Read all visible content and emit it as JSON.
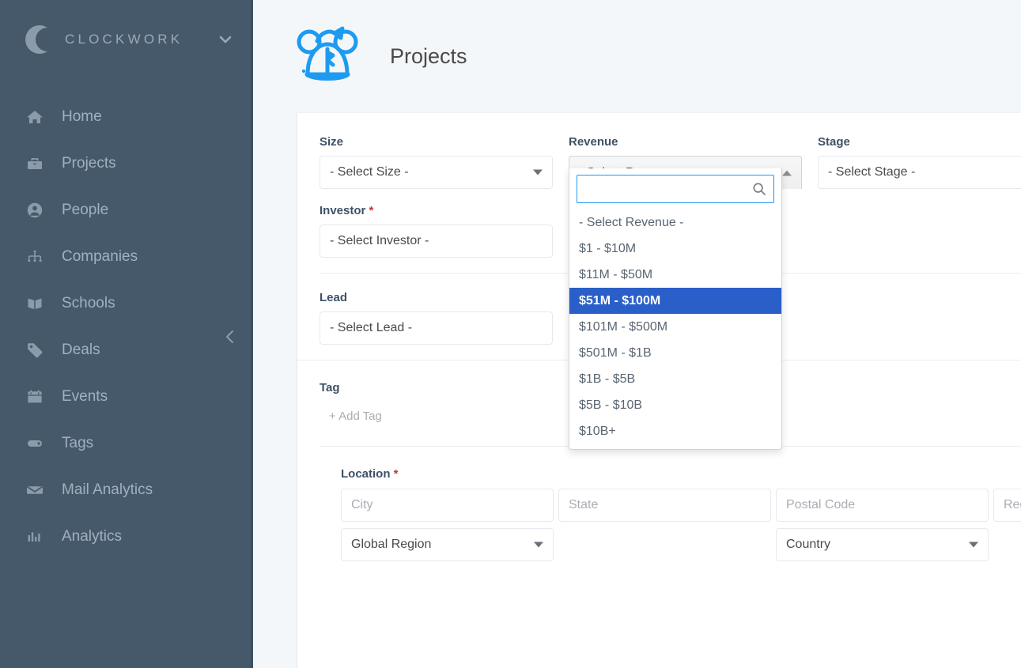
{
  "sidebar": {
    "brand": {
      "name": "CLOCKWORK",
      "logo_icon": "c-monogram-icon",
      "caret_icon": "chevron-down-icon"
    },
    "collapse_icon": "chevron-left-icon",
    "items": [
      {
        "label": "Home",
        "icon": "home-icon"
      },
      {
        "label": "Projects",
        "icon": "briefcase-icon"
      },
      {
        "label": "People",
        "icon": "user-circle-icon"
      },
      {
        "label": "Companies",
        "icon": "org-chart-icon"
      },
      {
        "label": "Schools",
        "icon": "book-icon"
      },
      {
        "label": "Deals",
        "icon": "tag-icon"
      },
      {
        "label": "Events",
        "icon": "calendar-icon"
      },
      {
        "label": "Tags",
        "icon": "label-icon"
      },
      {
        "label": "Mail Analytics",
        "icon": "envelope-icon"
      },
      {
        "label": "Analytics",
        "icon": "bar-chart-icon"
      }
    ]
  },
  "header": {
    "title": "Projects",
    "logo_icon": "koala-mascot-icon"
  },
  "form": {
    "size": {
      "label": "Size",
      "value": "- Select Size -",
      "caret_icon": "caret-down-icon"
    },
    "investor": {
      "label": "Investor",
      "required": "*",
      "value": "- Select Investor -"
    },
    "lead": {
      "label": "Lead",
      "value": "- Select Lead -"
    },
    "tag": {
      "label": "Tag",
      "add_label": "+ Add Tag"
    },
    "stage": {
      "label": "Stage",
      "value": "- Select Stage -",
      "caret_icon": "caret-down-icon"
    },
    "revenue": {
      "label": "Revenue",
      "toggle_value": "- Select Revenue -",
      "caret_icon": "caret-up-icon",
      "search_value": "",
      "search_placeholder": "",
      "search_icon": "search-icon",
      "selected_option": "$51M - $100M",
      "options": [
        "- Select Revenue -",
        "$1 - $10M",
        "$11M - $50M",
        "$51M - $100M",
        "$101M - $500M",
        "$501M - $1B",
        "$1B - $5B",
        "$5B - $10B",
        "$10B+"
      ]
    },
    "location": {
      "label": "Location",
      "required": "*",
      "city_placeholder": "City",
      "state_placeholder": "State",
      "postal_placeholder": "Postal Code",
      "region_placeholder": "Region",
      "global_region_value": "Global Region",
      "country_value": "Country"
    }
  },
  "colors": {
    "sidebar_bg": "#46596b",
    "accent_blue": "#1e9bf0",
    "selected_blue": "#2a5fc9",
    "required_red": "#c0392b",
    "page_bg": "#f4f7fa"
  }
}
